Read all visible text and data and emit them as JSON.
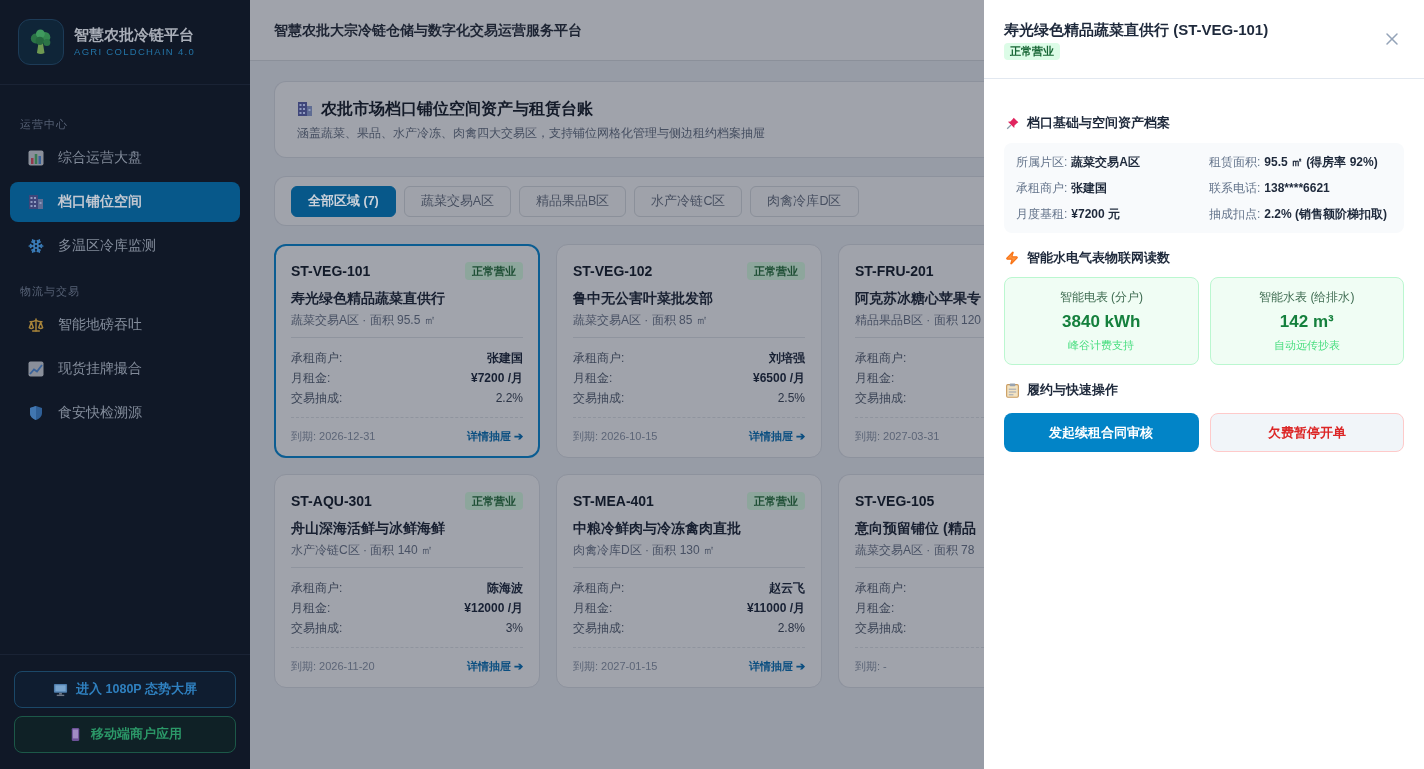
{
  "sidebar": {
    "brand": {
      "title": "智慧农批冷链平台",
      "subtitle": "AGRI COLDCHAIN 4.0"
    },
    "sections": [
      {
        "title": "运营中心",
        "items": [
          {
            "label": "综合运营大盘",
            "selected": false
          },
          {
            "label": "档口铺位空间",
            "selected": true
          },
          {
            "label": "多温区冷库监测",
            "selected": false
          }
        ]
      },
      {
        "title": "物流与交易",
        "items": [
          {
            "label": "智能地磅吞吐",
            "selected": false
          },
          {
            "label": "现货挂牌撮合",
            "selected": false
          },
          {
            "label": "食安快检溯源",
            "selected": false
          }
        ]
      }
    ],
    "buttons": [
      {
        "label": "进入 1080P 态势大屏",
        "kind": "screen"
      },
      {
        "label": "移动端商户应用",
        "kind": "app"
      }
    ]
  },
  "header": {
    "title": "智慧农批大宗冷链仓储与数字化交易运营服务平台"
  },
  "intro": {
    "title": "农批市场档口铺位空间资产与租赁台账",
    "subtitle": "涵盖蔬菜、果品、水产冷冻、肉禽四大交易区，支持铺位网格化管理与侧边租约档案抽屉"
  },
  "zone_tabs": [
    {
      "label": "全部区域 (7)",
      "selected": true
    },
    {
      "label": "蔬菜交易A区",
      "selected": false
    },
    {
      "label": "精品果品B区",
      "selected": false
    },
    {
      "label": "水产冷链C区",
      "selected": false
    },
    {
      "label": "肉禽冷库D区",
      "selected": false
    }
  ],
  "stall_cards": [
    {
      "code": "ST-VEG-101",
      "status": "正常营业",
      "name": "寿光绿色精品蔬菜直供行",
      "meta": "蔬菜交易A区 · 面积 95.5 ㎡",
      "fields": [
        {
          "label": "承租商户:",
          "value": "张建国"
        },
        {
          "label": "月租金:",
          "value": "¥7200 /月"
        },
        {
          "label": "交易抽成:",
          "value": "2.2%"
        }
      ],
      "expiry": "到期: 2026-12-31",
      "link": "详情抽屉 ➔",
      "selected": true
    },
    {
      "code": "ST-VEG-102",
      "status": "正常营业",
      "name": "鲁中无公害叶菜批发部",
      "meta": "蔬菜交易A区 · 面积 85 ㎡",
      "fields": [
        {
          "label": "承租商户:",
          "value": "刘培强"
        },
        {
          "label": "月租金:",
          "value": "¥6500 /月"
        },
        {
          "label": "交易抽成:",
          "value": "2.5%"
        }
      ],
      "expiry": "到期: 2026-10-15",
      "link": "详情抽屉 ➔",
      "selected": false
    },
    {
      "code": "ST-FRU-201",
      "name": "阿克苏冰糖心苹果专",
      "meta": "精品果品B区 · 面积 120",
      "fields": [
        {
          "label": "承租商户:"
        },
        {
          "label": "月租金:"
        },
        {
          "label": "交易抽成:"
        }
      ],
      "expiry": "到期: 2027-03-31",
      "selected": false
    },
    {
      "code": "ST-AQU-301",
      "status": "正常营业",
      "name": "舟山深海活鲜与冰鲜海鲜",
      "meta": "水产冷链C区 · 面积 140 ㎡",
      "fields": [
        {
          "label": "承租商户:",
          "value": "陈海波"
        },
        {
          "label": "月租金:",
          "value": "¥12000 /月"
        },
        {
          "label": "交易抽成:",
          "value": "3%"
        }
      ],
      "expiry": "到期: 2026-11-20",
      "link": "详情抽屉 ➔",
      "selected": false
    },
    {
      "code": "ST-MEA-401",
      "status": "正常营业",
      "name": "中粮冷鲜肉与冷冻禽肉直批",
      "meta": "肉禽冷库D区 · 面积 130 ㎡",
      "fields": [
        {
          "label": "承租商户:",
          "value": "赵云飞"
        },
        {
          "label": "月租金:",
          "value": "¥11000 /月"
        },
        {
          "label": "交易抽成:",
          "value": "2.8%"
        }
      ],
      "expiry": "到期: 2027-01-15",
      "link": "详情抽屉 ➔",
      "selected": false
    },
    {
      "code": "ST-VEG-105",
      "name": "意向预留铺位 (精品",
      "meta": "蔬菜交易A区 · 面积 78",
      "fields": [
        {
          "label": "承租商户:"
        },
        {
          "label": "月租金:"
        },
        {
          "label": "交易抽成:"
        }
      ],
      "expiry": "到期: -",
      "selected": false
    }
  ],
  "drawer": {
    "title": "寿光绿色精品蔬菜直供行 (ST-VEG-101)",
    "status": "正常营业",
    "profile": {
      "title": "档口基础与空间资产档案",
      "fields": [
        {
          "label": "所属片区:",
          "value": "蔬菜交易A区"
        },
        {
          "label": "租赁面积:",
          "value": "95.5 ㎡ (得房率 92%)"
        },
        {
          "label": "承租商户:",
          "value": "张建国"
        },
        {
          "label": "联系电话:",
          "value": "138****6621"
        },
        {
          "label": "月度基租:",
          "value": "¥7200 元"
        },
        {
          "label": "抽成扣点:",
          "value": "2.2% (销售额阶梯扣取)"
        }
      ]
    },
    "meters": {
      "title": "智能水电气表物联网读数",
      "items": [
        {
          "label": "智能电表 (分户)",
          "reading": "3840 kWh",
          "note": "峰谷计费支持"
        },
        {
          "label": "智能水表 (给排水)",
          "reading": "142 m³",
          "note": "自动远传抄表"
        }
      ]
    },
    "actions": {
      "title": "履约与快速操作",
      "buttons": [
        {
          "label": "发起续租合同审核",
          "kind": "primary"
        },
        {
          "label": "欠费暂停开单",
          "kind": "danger"
        }
      ]
    }
  }
}
